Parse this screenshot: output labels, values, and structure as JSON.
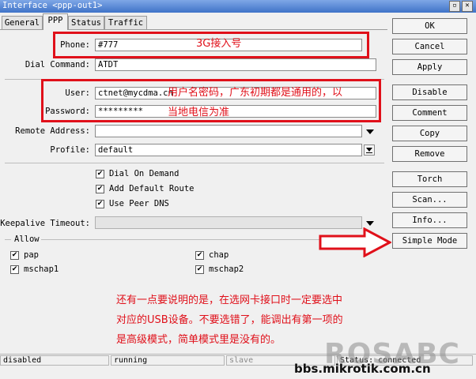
{
  "window": {
    "title": "Interface <ppp-out1>"
  },
  "tabs": [
    "General",
    "PPP",
    "Status",
    "Traffic"
  ],
  "fields": {
    "phone_label": "Phone:",
    "phone_value": "#777",
    "dial_label": "Dial Command:",
    "dial_value": "ATDT",
    "user_label": "User:",
    "user_value": "ctnet@mycdma.cn",
    "password_label": "Password:",
    "password_value": "*********",
    "remote_label": "Remote Address:",
    "remote_value": "",
    "profile_label": "Profile:",
    "profile_value": "default",
    "keepalive_label": "Keepalive Timeout:",
    "keepalive_value": ""
  },
  "options": [
    {
      "label": "Dial On Demand",
      "checked": true
    },
    {
      "label": "Add Default Route",
      "checked": true
    },
    {
      "label": "Use Peer DNS",
      "checked": true
    }
  ],
  "allow": {
    "title": "Allow",
    "items": [
      {
        "label": "pap",
        "checked": true
      },
      {
        "label": "chap",
        "checked": true
      },
      {
        "label": "mschap1",
        "checked": true
      },
      {
        "label": "mschap2",
        "checked": true
      }
    ]
  },
  "buttons": [
    "OK",
    "Cancel",
    "Apply",
    "Disable",
    "Comment",
    "Copy",
    "Remove",
    "Torch",
    "Scan...",
    "Info...",
    "Simple Mode"
  ],
  "status": {
    "state": "disabled",
    "running": "running",
    "slave": "slave",
    "status": "Status: connected"
  },
  "annotations": {
    "phone": "3G接入号",
    "user_line1": "用户名密码，广东初期都是通用的，以",
    "user_line2": "当地电信为准",
    "note_line1": "还有一点要说明的是，在选网卡接口时一定要选中",
    "note_line2": "对应的USB设备。不要选错了，能调出有第一项的",
    "note_line3": "是高级模式，简单模式里是没有的。"
  },
  "watermark": {
    "logo": "ROSABC",
    "site": "bbs.mikrotik.com.cn"
  },
  "colors": {
    "annotation": "#e0101a",
    "titlebar": "#3f73c8"
  }
}
